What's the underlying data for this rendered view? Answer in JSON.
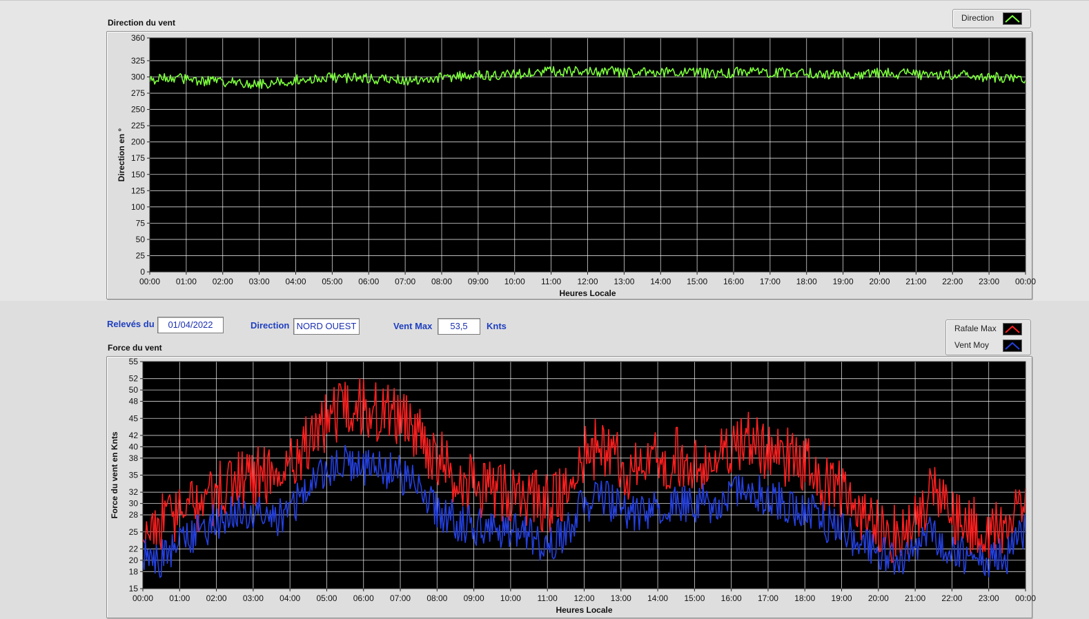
{
  "top_panel": {
    "title": "Direction du vent"
  },
  "bottom_panel": {
    "title": "Force du vent"
  },
  "info_bar": {
    "releves_label": "Relevés du",
    "date_value": "01/04/2022",
    "direction_label": "Direction",
    "direction_value": "NORD OUEST",
    "ventmax_label": "Vent Max",
    "ventmax_value": "53,5",
    "unit_label": "Knts"
  },
  "legend_top": {
    "items": [
      {
        "label": "Direction",
        "color": "#7cff3c"
      }
    ]
  },
  "legend_bottom": {
    "items": [
      {
        "label": "Rafale Max",
        "color": "#ff1f1f"
      },
      {
        "label": "Vent Moy",
        "color": "#2440e0"
      }
    ]
  },
  "colors": {
    "plot_bg": "#000000",
    "grid": "#ffffff",
    "direction": "#7cff3c",
    "rafale": "#ff1f1f",
    "moyen": "#2440e0"
  },
  "chart_data": [
    {
      "type": "line",
      "title": "Direction du vent",
      "xlabel": "Heures Locale",
      "ylabel": "Direction en °",
      "xlim": [
        0,
        24
      ],
      "ylim": [
        0,
        360
      ],
      "x_tick_labels": [
        "00:00",
        "01:00",
        "02:00",
        "03:00",
        "04:00",
        "05:00",
        "06:00",
        "07:00",
        "08:00",
        "09:00",
        "10:00",
        "11:00",
        "12:00",
        "13:00",
        "14:00",
        "15:00",
        "16:00",
        "17:00",
        "18:00",
        "19:00",
        "20:00",
        "21:00",
        "22:00",
        "23:00",
        "00:00"
      ],
      "y_ticks": [
        0,
        25,
        50,
        75,
        100,
        125,
        150,
        175,
        200,
        225,
        250,
        275,
        300,
        325,
        360
      ],
      "grid": true,
      "legend": "top-right",
      "series": [
        {
          "name": "Direction",
          "x": [
            0,
            0.5,
            1,
            1.5,
            2,
            2.5,
            3,
            3.5,
            4,
            4.5,
            5,
            5.5,
            6,
            6.5,
            7,
            7.5,
            8,
            8.5,
            9,
            9.5,
            10,
            10.5,
            11,
            11.5,
            12,
            12.5,
            13,
            13.5,
            14,
            14.5,
            15,
            15.5,
            16,
            16.5,
            17,
            17.5,
            18,
            18.5,
            19,
            19.5,
            20,
            20.5,
            21,
            21.5,
            22,
            22.5,
            23,
            23.5,
            24
          ],
          "values": [
            296,
            299,
            297,
            294,
            292,
            290,
            289,
            292,
            296,
            298,
            299,
            298,
            297,
            296,
            295,
            297,
            299,
            301,
            302,
            303,
            304,
            306,
            309,
            308,
            308,
            309,
            307,
            306,
            307,
            307,
            306,
            305,
            307,
            310,
            307,
            306,
            306,
            305,
            304,
            305,
            306,
            305,
            304,
            303,
            304,
            302,
            300,
            298,
            298
          ]
        }
      ]
    },
    {
      "type": "line",
      "title": "Force du vent",
      "xlabel": "Heures Locale",
      "ylabel": "Force du vent en Knts",
      "xlim": [
        0,
        24
      ],
      "ylim": [
        15,
        55
      ],
      "x_tick_labels": [
        "00:00",
        "01:00",
        "02:00",
        "03:00",
        "04:00",
        "05:00",
        "06:00",
        "07:00",
        "08:00",
        "09:00",
        "10:00",
        "11:00",
        "12:00",
        "13:00",
        "14:00",
        "15:00",
        "16:00",
        "17:00",
        "18:00",
        "19:00",
        "20:00",
        "21:00",
        "22:00",
        "23:00",
        "00:00"
      ],
      "y_ticks": [
        15,
        18,
        20,
        22,
        25,
        28,
        30,
        32,
        35,
        38,
        40,
        42,
        45,
        48,
        50,
        52,
        55
      ],
      "grid": true,
      "legend": "top-right",
      "series": [
        {
          "name": "Rafale Max",
          "x": [
            0,
            0.5,
            1,
            1.5,
            2,
            2.5,
            3,
            3.5,
            4,
            4.5,
            5,
            5.5,
            6,
            6.5,
            7,
            7.5,
            8,
            8.5,
            9,
            9.5,
            10,
            10.5,
            11,
            11.5,
            12,
            12.5,
            13,
            13.5,
            14,
            14.5,
            15,
            15.5,
            16,
            16.5,
            17,
            17.5,
            18,
            18.5,
            19,
            19.5,
            20,
            20.5,
            21,
            21.5,
            22,
            22.5,
            23,
            23.5,
            24
          ],
          "values": [
            26,
            27,
            28,
            30,
            32,
            34,
            35,
            35,
            37,
            41,
            45,
            46,
            47,
            46,
            45,
            42,
            38,
            35,
            33,
            32,
            32,
            31,
            30,
            31,
            39,
            40,
            37,
            35,
            38,
            38,
            37,
            38,
            39,
            41,
            39,
            38,
            37,
            34,
            32,
            28,
            26,
            24,
            26,
            33,
            27,
            26,
            24,
            26,
            33
          ]
        },
        {
          "name": "Vent Moy",
          "x": [
            0,
            0.5,
            1,
            1.5,
            2,
            2.5,
            3,
            3.5,
            4,
            4.5,
            5,
            5.5,
            6,
            6.5,
            7,
            7.5,
            8,
            8.5,
            9,
            9.5,
            10,
            10.5,
            11,
            11.5,
            12,
            12.5,
            13,
            13.5,
            14,
            14.5,
            15,
            15.5,
            16,
            16.5,
            17,
            17.5,
            18,
            18.5,
            19,
            19.5,
            20,
            20.5,
            21,
            21.5,
            22,
            22.5,
            23,
            23.5,
            24
          ],
          "values": [
            21,
            20,
            23,
            25,
            27,
            28,
            28,
            27,
            29,
            33,
            36,
            37,
            36,
            36,
            35,
            33,
            29,
            27,
            26,
            25,
            25,
            24,
            23,
            25,
            30,
            31,
            29,
            28,
            30,
            30,
            30,
            30,
            31,
            33,
            31,
            30,
            29,
            27,
            25,
            23,
            21,
            20,
            21,
            25,
            21,
            21,
            20,
            21,
            25
          ]
        }
      ]
    }
  ]
}
